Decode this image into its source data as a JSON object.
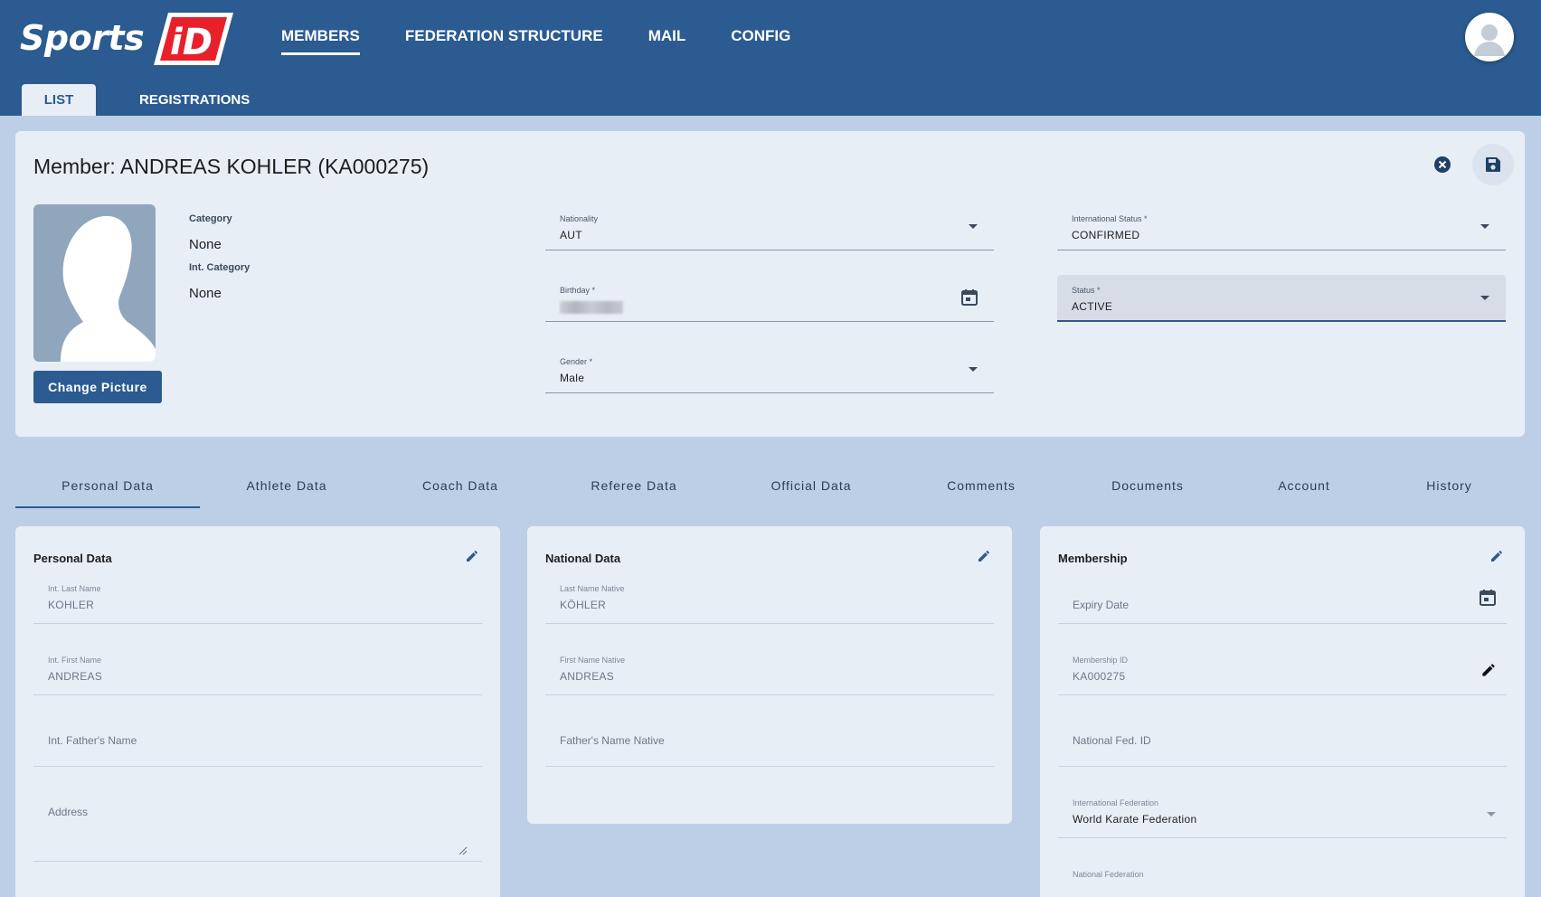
{
  "header": {
    "logo_text": "Sports",
    "logo_id": "iD",
    "nav": [
      "MEMBERS",
      "FEDERATION STRUCTURE",
      "MAIL",
      "CONFIG"
    ],
    "subtabs": [
      "LIST",
      "REGISTRATIONS"
    ]
  },
  "member": {
    "title": "Member: ANDREAS KOHLER (KA000275)",
    "change_picture": "Change Picture",
    "category_label": "Category",
    "category_value": "None",
    "int_category_label": "Int. Category",
    "int_category_value": "None",
    "nationality_label": "Nationality",
    "nationality_value": "AUT",
    "birthday_label": "Birthday *",
    "gender_label": "Gender *",
    "gender_value": "Male",
    "int_status_label": "International Status *",
    "int_status_value": "CONFIRMED",
    "status_label": "Status *",
    "status_value": "ACTIVE"
  },
  "section_tabs": [
    "Personal Data",
    "Athlete Data",
    "Coach Data",
    "Referee Data",
    "Official Data",
    "Comments",
    "Documents",
    "Account",
    "History"
  ],
  "personal": {
    "title": "Personal Data",
    "last_name_label": "Int. Last Name",
    "last_name_value": "KOHLER",
    "first_name_label": "Int. First Name",
    "first_name_value": "ANDREAS",
    "father_placeholder": "Int. Father's Name",
    "address_placeholder": "Address"
  },
  "national": {
    "title": "National Data",
    "last_name_label": "Last Name Native",
    "last_name_value": "KÖHLER",
    "first_name_label": "First Name Native",
    "first_name_value": "ANDREAS",
    "father_placeholder": "Father's Name Native"
  },
  "membership": {
    "title": "Membership",
    "expiry_placeholder": "Expiry Date",
    "membership_id_label": "Membership ID",
    "membership_id_value": "KA000275",
    "national_fed_id_placeholder": "National Fed. ID",
    "int_federation_label": "International Federation",
    "int_federation_value": "World Karate Federation",
    "national_federation_label": "National Federation"
  },
  "colors": {
    "header": "#2b5b90",
    "background": "#bccfe6",
    "card": "#e8eef6",
    "logo_red": "#e8202a"
  }
}
